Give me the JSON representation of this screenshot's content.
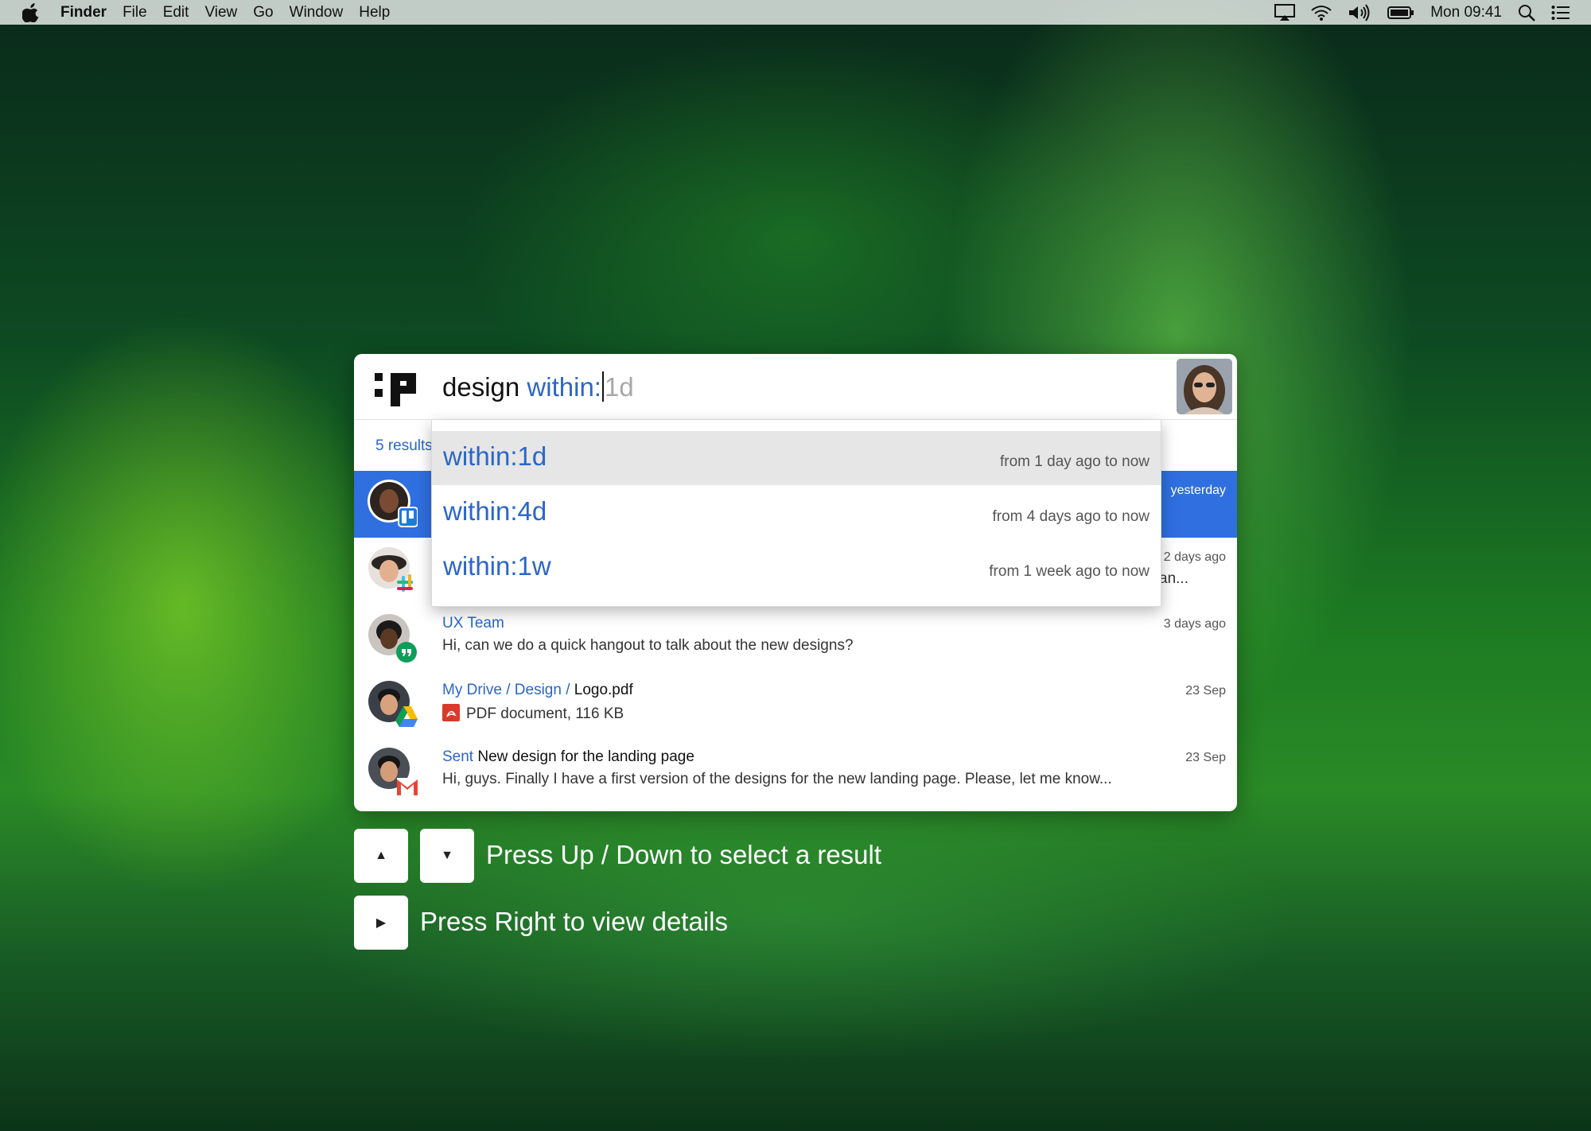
{
  "menubar": {
    "app": "Finder",
    "items": [
      "File",
      "Edit",
      "View",
      "Go",
      "Window",
      "Help"
    ],
    "clock": "Mon 09:41"
  },
  "search": {
    "query_plain": "design",
    "query_keyword": "within:",
    "query_hint": "1d"
  },
  "results_count": "5 results",
  "results": [
    {
      "title": "",
      "subtitle": "",
      "time": "yesterday"
    },
    {
      "title": "",
      "subtitle": "an...",
      "time": "2 days ago"
    },
    {
      "title": "UX Team",
      "subtitle": "Hi, can we do a quick hangout to talk about the new designs?",
      "time": "3 days ago"
    },
    {
      "path": "My Drive / Design /",
      "file": "Logo.pdf",
      "subtitle": "PDF document, 116 KB",
      "time": "23 Sep"
    },
    {
      "label": "Sent",
      "title": "New design for the landing page",
      "subtitle": "Hi, guys. Finally I have a first version of the designs for the new landing page. Please, let me know...",
      "time": "23 Sep"
    }
  ],
  "suggestions": [
    {
      "label": "within:1d",
      "desc": "from 1 day ago to now"
    },
    {
      "label": "within:4d",
      "desc": "from 4 days ago to now"
    },
    {
      "label": "within:1w",
      "desc": "from 1 week ago to now"
    }
  ],
  "hints": {
    "up_key": "▲",
    "down_key": "▼",
    "right_key": "▶",
    "up_down": "Press Up / Down to select a result",
    "right": "Press Right to view details"
  },
  "colors": {
    "accent": "#2a66c9",
    "selected_row": "#2f6fe0"
  }
}
